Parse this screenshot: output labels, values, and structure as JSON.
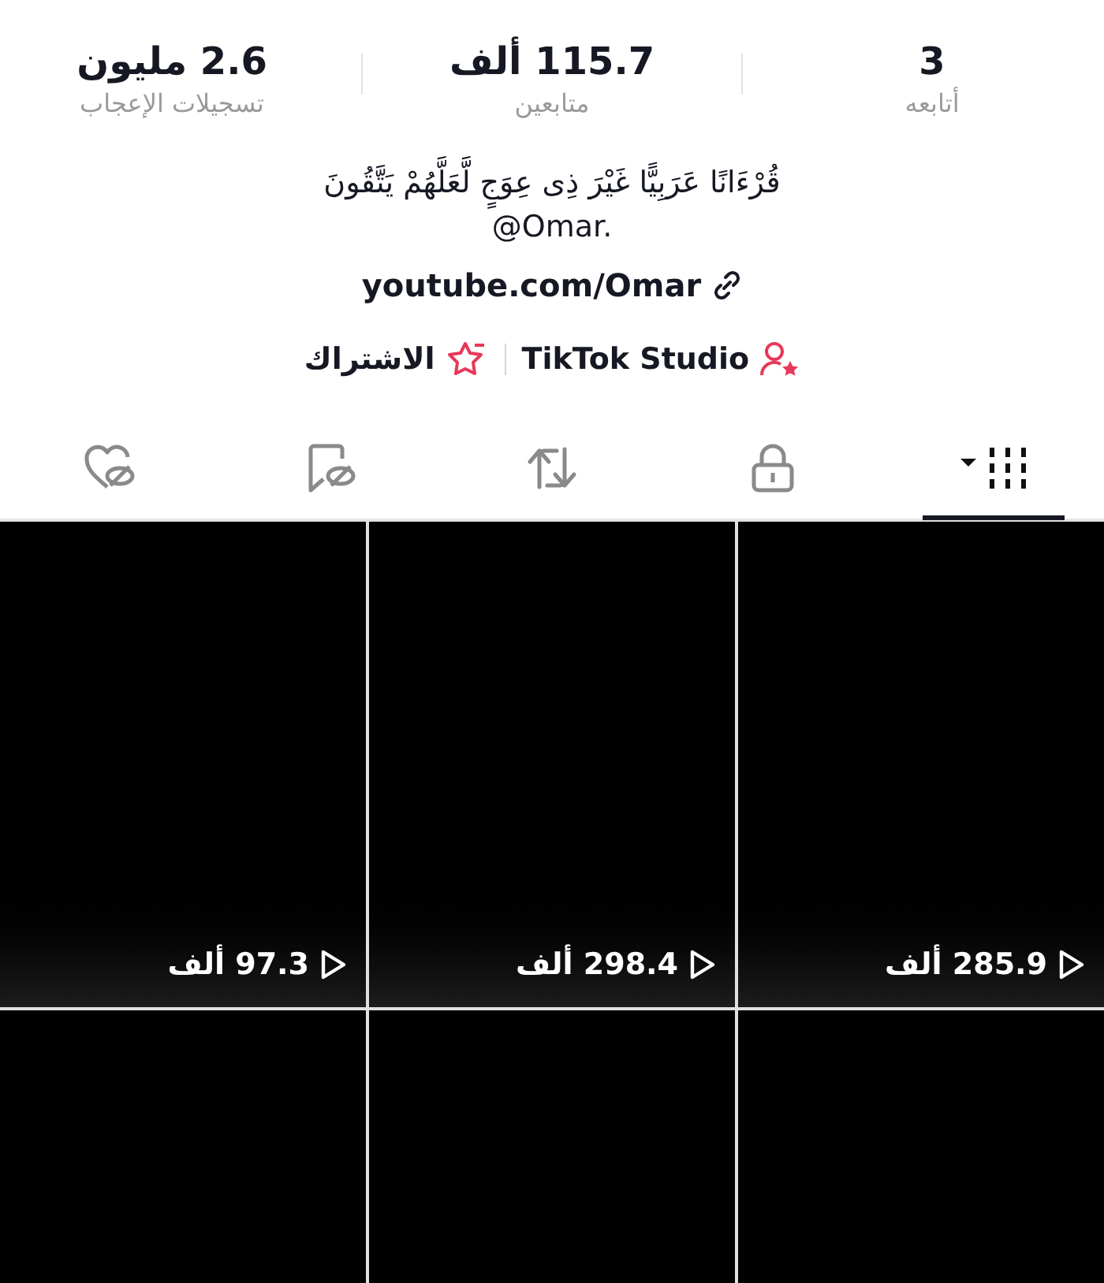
{
  "stats": [
    {
      "value": "3",
      "label": "أتابعه"
    },
    {
      "value": "115.7 ألف",
      "label": "متابعين"
    },
    {
      "value": "2.6 مليون",
      "label": "تسجيلات الإعجاب"
    }
  ],
  "bio": [
    "قُرْءَانًا عَرَبِيًّا غَيْرَ ذِى عِوَجٍ لَّعَلَّهُمْ يَتَّقُونَ",
    "@Omar."
  ],
  "link": "youtube.com/Omar",
  "actions": [
    {
      "kind": "studio",
      "label": "TikTok Studio"
    },
    {
      "kind": "subscribe",
      "label": "الاشتراك"
    }
  ],
  "tabs": [
    {
      "kind": "videos",
      "selected": true
    },
    {
      "kind": "private",
      "selected": false
    },
    {
      "kind": "reposts",
      "selected": false
    },
    {
      "kind": "favorites",
      "selected": false
    },
    {
      "kind": "liked",
      "selected": false
    }
  ],
  "videos": [
    {
      "kind": "counted",
      "views": "285.9 ألف"
    },
    {
      "kind": "counted",
      "views": "298.4 ألف"
    },
    {
      "kind": "counted",
      "views": "97.3 ألف"
    },
    {
      "kind": "plain"
    },
    {
      "kind": "plain"
    },
    {
      "kind": "plain"
    }
  ]
}
